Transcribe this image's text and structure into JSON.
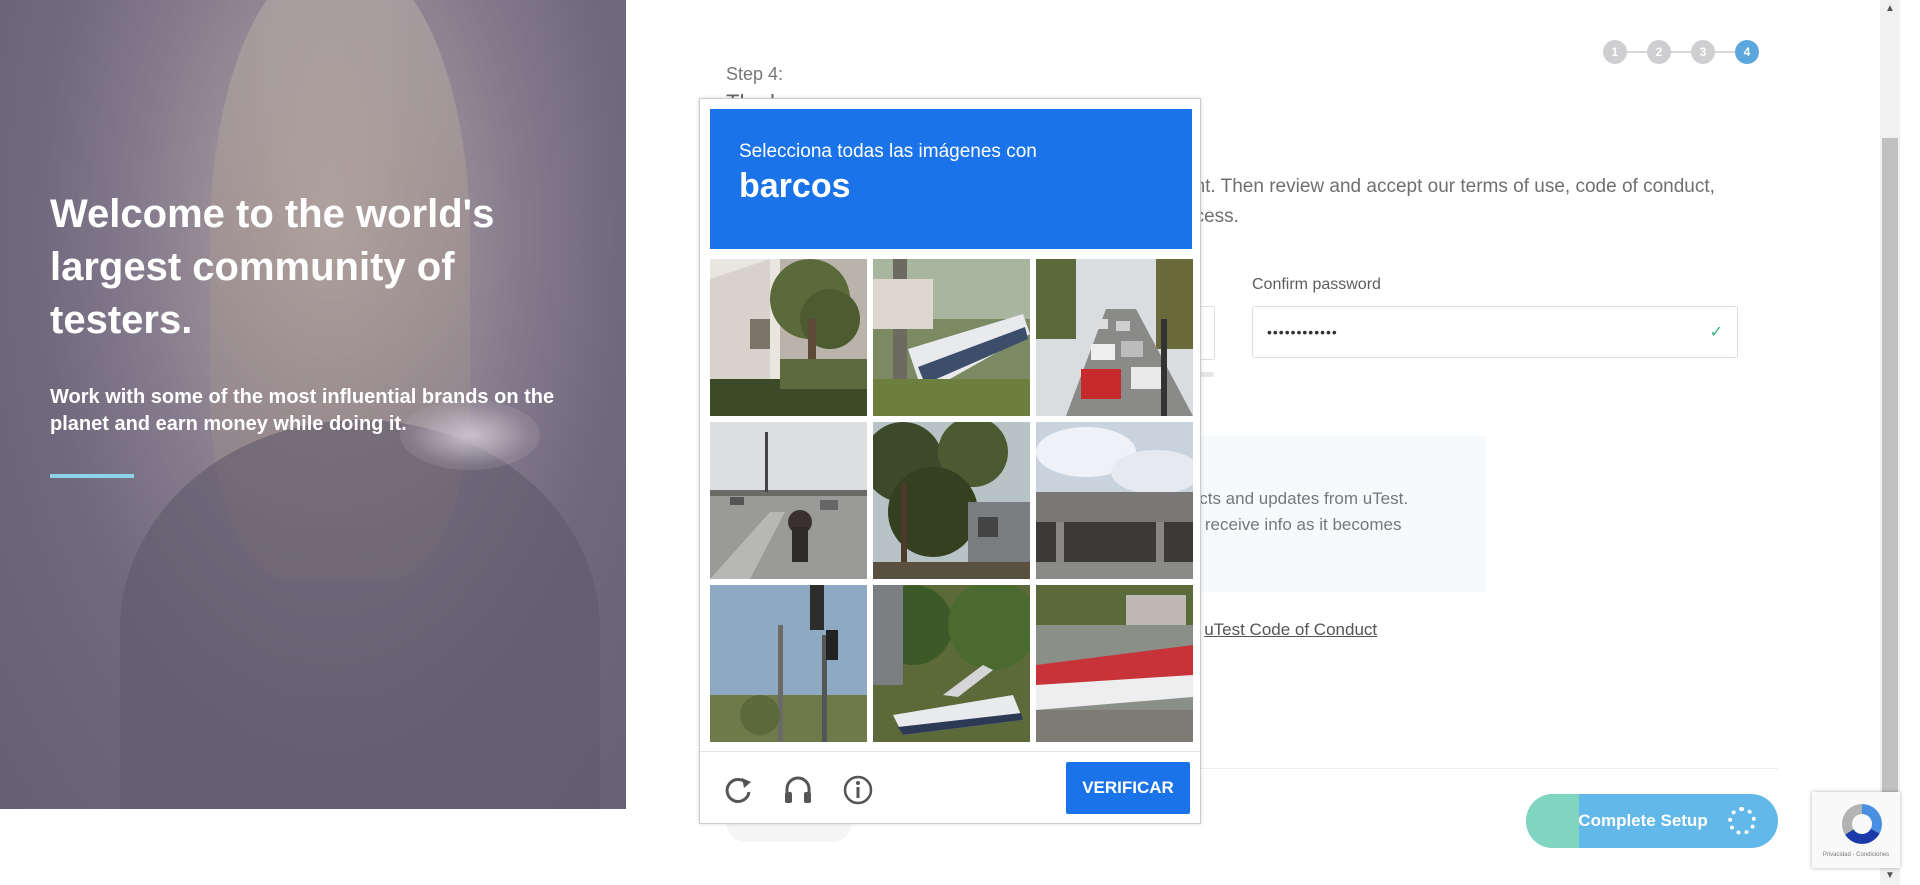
{
  "hero": {
    "title": "Welcome to the world's largest community of testers.",
    "subtitle": "Work with some of the most influential brands on the planet and earn money while doing it."
  },
  "stepper": {
    "steps": [
      "1",
      "2",
      "3",
      "4"
    ],
    "active": "4"
  },
  "form": {
    "step_label": "Step 4:",
    "step_heading_fragment": "Th...k...",
    "intro_line1": "unt. Then review and accept our terms of use, code of conduct,",
    "intro_line2": "ocess.",
    "confirm_password_label": "Confirm password",
    "confirm_password_value": "••••••••••••",
    "optin_line1": "jects and updates from uTest.",
    "optin_line2": "to receive info as it becomes",
    "conduct_prefix": "e ",
    "conduct_link": "uTest Code of Conduct",
    "complete_button": "Complete Setup"
  },
  "captcha": {
    "instruction": "Selecciona todas las imágenes con",
    "target": "barcos",
    "tiles": [
      "palm-house",
      "boat-trailer",
      "traffic-street",
      "highway-motorcycle",
      "trees-cabin",
      "bridge-sky",
      "traffic-light-pole",
      "speedboat-trees",
      "red-boat-trailer"
    ],
    "verify_button": "VERIFICAR",
    "colors": {
      "header": "#1a73e8"
    }
  },
  "recaptcha_badge": {
    "terms": "Privacidad - Condiciones"
  }
}
